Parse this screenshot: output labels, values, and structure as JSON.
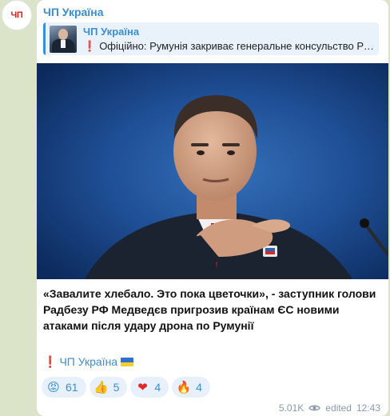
{
  "avatar_text": "ЧП",
  "channel_name": "ЧП Україна",
  "reply": {
    "title": "ЧП Україна",
    "mark": "❗",
    "text": "Офіційно: Румунія закриває генеральне консульство РФ у Констанці"
  },
  "caption": "«Завалите хлебало. Это пока цветочки», - заступник голови Радбезу РФ Медведєв пригрозив країнам ЄС новими атаками після удару дрона по Румунії",
  "signature": {
    "mark": "❗",
    "name": "ЧП Україна"
  },
  "reactions": [
    {
      "icon": "angry-face-icon",
      "glyph": "😡",
      "count": "61"
    },
    {
      "icon": "thumbs-up-icon",
      "glyph": "👍",
      "count": "5"
    },
    {
      "icon": "heart-icon",
      "glyph": "❤",
      "count": "4"
    },
    {
      "icon": "fire-icon",
      "glyph": "🔥",
      "count": "4"
    }
  ],
  "footer": {
    "views": "5.01K",
    "edited": "edited",
    "time": "12:43"
  },
  "colors": {
    "background": "#dbe4c9",
    "accent": "#3a8ed0",
    "alert": "#e0282b"
  }
}
